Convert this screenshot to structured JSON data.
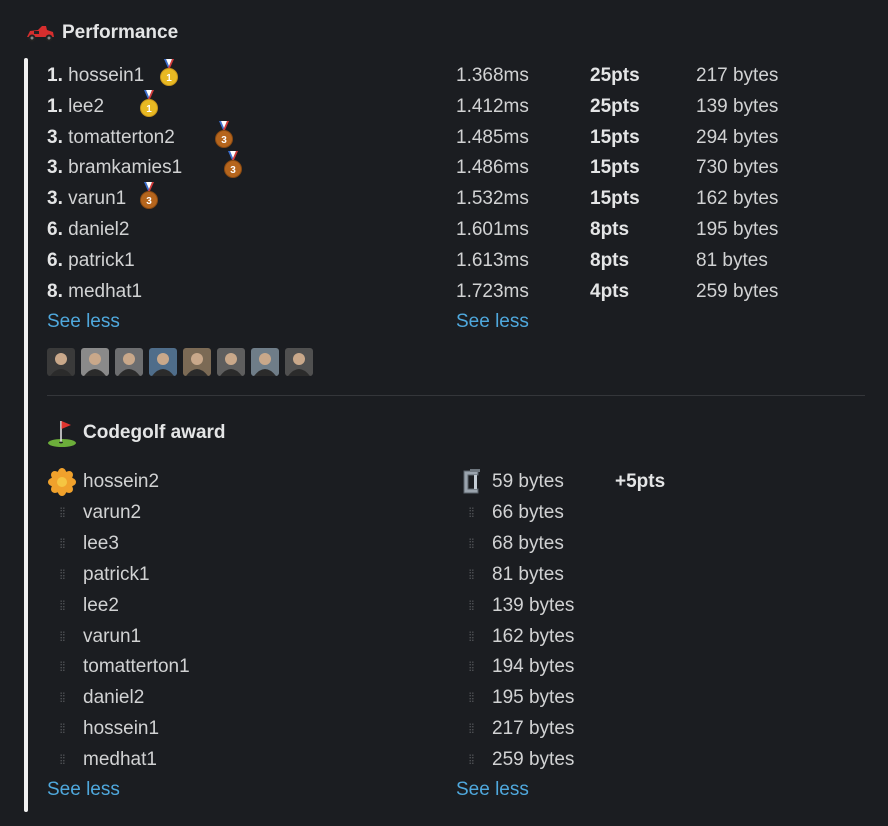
{
  "performance": {
    "title": "Performance",
    "header_icon": "racing-car-icon",
    "rows": [
      {
        "rank": "1.",
        "name": "hossein1",
        "medal": "gold",
        "time": "1.368ms",
        "pts": "25pts",
        "bytes": "217 bytes"
      },
      {
        "rank": "1.",
        "name": "lee2",
        "medal": "gold",
        "time": "1.412ms",
        "pts": "25pts",
        "bytes": "139 bytes"
      },
      {
        "rank": "3.",
        "name": "tomatterton2",
        "medal": "bronze",
        "time": "1.485ms",
        "pts": "15pts",
        "bytes": "294 bytes"
      },
      {
        "rank": "3.",
        "name": "bramkamies1",
        "medal": "bronze",
        "time": "1.486ms",
        "pts": "15pts",
        "bytes": "730 bytes"
      },
      {
        "rank": "3.",
        "name": "varun1",
        "medal": "bronze",
        "time": "1.532ms",
        "pts": "15pts",
        "bytes": "162 bytes"
      },
      {
        "rank": "6.",
        "name": "daniel2",
        "medal": "",
        "time": "1.601ms",
        "pts": "8pts",
        "bytes": "195 bytes"
      },
      {
        "rank": "6.",
        "name": "patrick1",
        "medal": "",
        "time": "1.613ms",
        "pts": "8pts",
        "bytes": "81 bytes"
      },
      {
        "rank": "8.",
        "name": "medhat1",
        "medal": "",
        "time": "1.723ms",
        "pts": "4pts",
        "bytes": "259 bytes"
      }
    ],
    "see_less_left": "See less",
    "see_less_right": "See less",
    "avatar_count": 8
  },
  "codegolf": {
    "title": "Codegolf award",
    "header_icon": "golf-flag-icon",
    "rows": [
      {
        "name": "hossein2",
        "bytes": "59 bytes",
        "left_icon": "flower-icon",
        "right_icon": "clamp-icon",
        "bonus": "+5pts"
      },
      {
        "name": "varun2",
        "bytes": "66 bytes"
      },
      {
        "name": "lee3",
        "bytes": "68 bytes"
      },
      {
        "name": "patrick1",
        "bytes": "81 bytes"
      },
      {
        "name": "lee2",
        "bytes": "139 bytes"
      },
      {
        "name": "varun1",
        "bytes": "162 bytes"
      },
      {
        "name": "tomatterton1",
        "bytes": "194 bytes"
      },
      {
        "name": "daniel2",
        "bytes": "195 bytes"
      },
      {
        "name": "hossein1",
        "bytes": "217 bytes"
      },
      {
        "name": "medhat1",
        "bytes": "259 bytes"
      }
    ],
    "see_less_left": "See less",
    "see_less_right": "See less"
  },
  "colors": {
    "background": "#1b1d21",
    "link": "#4fa8dd",
    "gold": "#e8b923",
    "bronze": "#b5651d"
  }
}
